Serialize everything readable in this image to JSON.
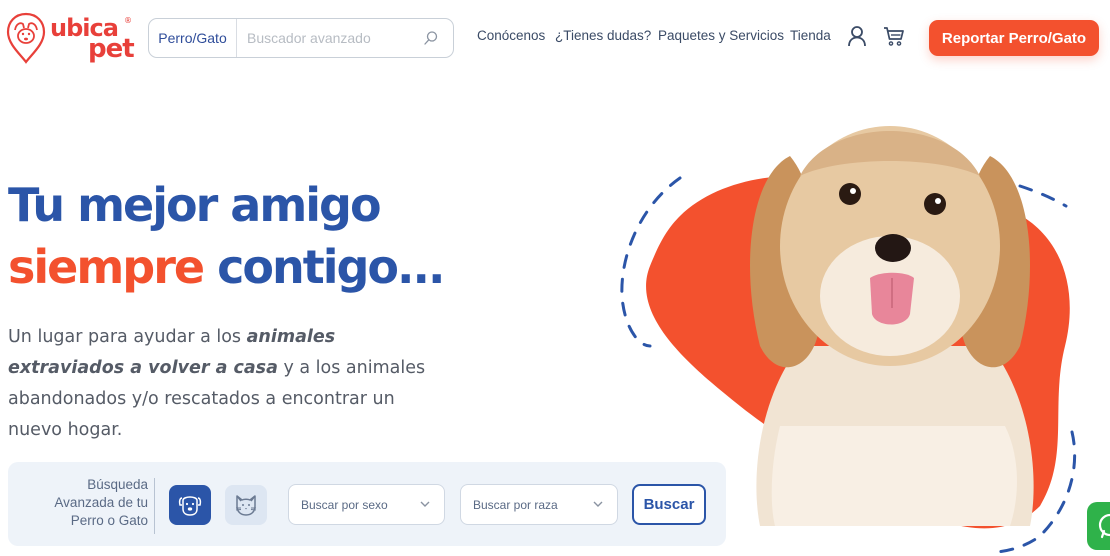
{
  "logo": {
    "line1": "ubica",
    "line2": "pet",
    "reg": "®"
  },
  "search": {
    "type_label": "Perro/Gato",
    "placeholder": "Buscador avanzado",
    "value": ""
  },
  "nav": {
    "items": [
      "Conócenos",
      "¿Tienes dudas?",
      "Paquetes y Servicios",
      "Tienda"
    ]
  },
  "icons": {
    "user": "user-icon",
    "cart": "cart-icon",
    "search": "search-icon",
    "dog": "dog-icon",
    "cat": "cat-icon",
    "chevron": "chevron-down-icon",
    "whatsapp": "whatsapp-icon"
  },
  "cta": {
    "report_label": "Reportar Perro/Gato"
  },
  "hero": {
    "line1": "Tu mejor amigo",
    "line2_orange": "siempre",
    "line2_blue": " contigo...",
    "desc_part1": "Un lugar para ayudar a los ",
    "desc_bold": "animales extraviados a volver a casa",
    "desc_part2": " y a los animales abandonados y/o rescatados a encontrar un nuevo hogar."
  },
  "advanced_search": {
    "label": "Búsqueda Avanzada de tu Perro o Gato",
    "sex_select": "Buscar por sexo",
    "breed_select": "Buscar por raza",
    "submit_label": "Buscar"
  },
  "colors": {
    "brand_orange": "#f3512e",
    "brand_blue": "#2b55a8",
    "panel_bg": "#eef3f9",
    "whatsapp_green": "#2fb24a"
  }
}
